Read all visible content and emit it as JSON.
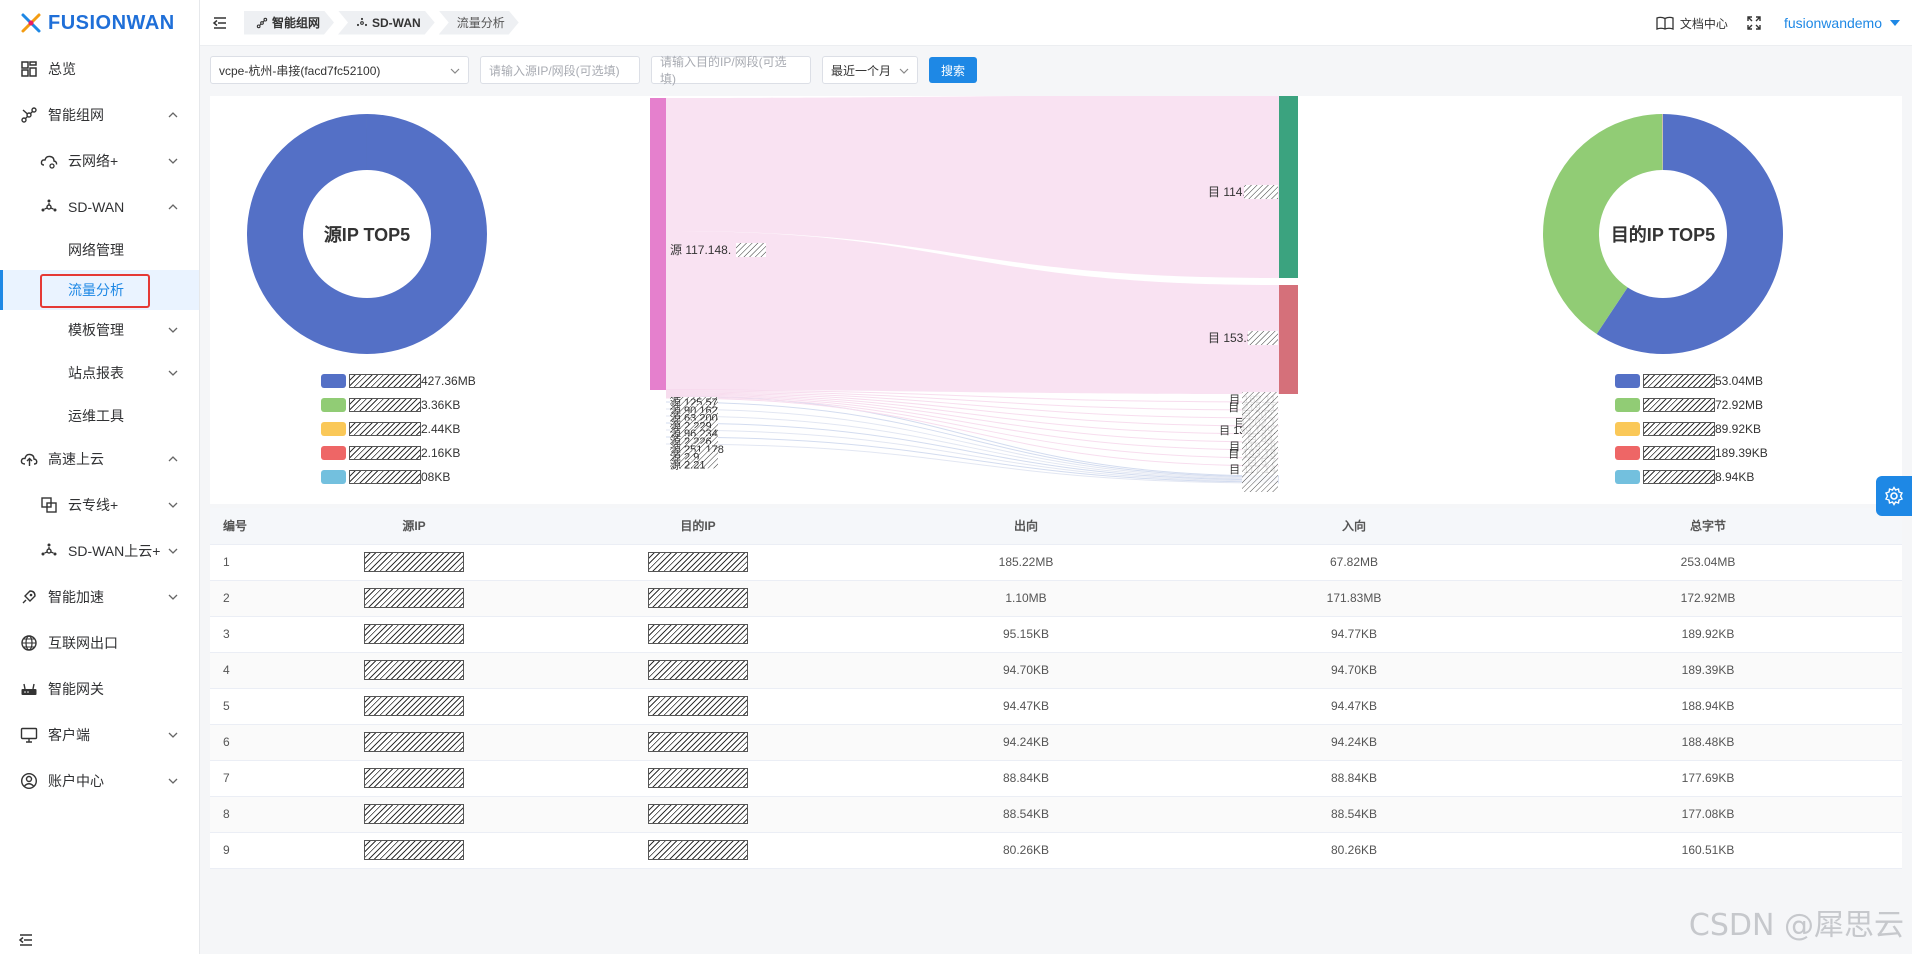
{
  "brand": {
    "name": "FUSIONWAN"
  },
  "sidebar": {
    "items": [
      {
        "label": "总览",
        "icon": "dashboard-icon"
      },
      {
        "label": "智能组网",
        "icon": "network-icon"
      },
      {
        "label": "云网络+",
        "icon": "cloud-network-icon"
      },
      {
        "label": "SD-WAN",
        "icon": "sdwan-icon"
      },
      {
        "label": "网络管理"
      },
      {
        "label": "流量分析"
      },
      {
        "label": "模板管理"
      },
      {
        "label": "站点报表"
      },
      {
        "label": "运维工具"
      },
      {
        "label": "高速上云",
        "icon": "cloud-upload-icon"
      },
      {
        "label": "云专线+",
        "icon": "dedicated-line-icon"
      },
      {
        "label": "SD-WAN上云+",
        "icon": "sdwan-cloud-icon"
      },
      {
        "label": "智能加速",
        "icon": "rocket-icon"
      },
      {
        "label": "互联网出口",
        "icon": "globe-icon"
      },
      {
        "label": "智能网关",
        "icon": "router-icon"
      },
      {
        "label": "客户端",
        "icon": "monitor-icon"
      },
      {
        "label": "账户中心",
        "icon": "user-circle-icon"
      }
    ]
  },
  "header": {
    "breadcrumbs": [
      "智能组网",
      "SD-WAN",
      "流量分析"
    ],
    "docs_label": "文档中心",
    "username": "fusionwandemo"
  },
  "filters": {
    "device": "vcpe-杭州-串接(facd7fc52100)",
    "src_placeholder": "请输入源IP/网段(可选填)",
    "dst_placeholder": "请输入目的IP/网段(可选填)",
    "period": "最近一个月",
    "search_label": "搜索"
  },
  "colors": {
    "accent": "#1e88e5",
    "series": [
      "#5470c6",
      "#91cc75",
      "#fac858",
      "#ee6666",
      "#73c0de"
    ]
  },
  "charts": {
    "src_title": "源IP TOP5",
    "src_legend": [
      "427.36MB",
      "3.36KB",
      "2.44KB",
      "2.16KB",
      "08KB"
    ],
    "dst_title": "目的IP TOP5",
    "dst_legend": [
      "53.04MB",
      "72.92MB",
      "89.92KB",
      "189.39KB",
      "8.94KB"
    ],
    "sankey_labels": {
      "source_main": "源 117.148.",
      "target_1": "目 114.118",
      "target_2": "目 153.37.",
      "source_small": [
        "源 125.57",
        "源 90.162",
        "源 63.200",
        "源 2.229",
        "源 96.234",
        "源 2.226",
        "源 251.178",
        "源 2.9",
        "源 2.21"
      ],
      "target_small": [
        "目 162.11",
        "目 219.21",
        "目 202.",
        "目 202.1",
        "目 139.199.",
        "目 84.",
        "目 119.28",
        "目 193.18",
        "目 5.7",
        "目 117.14"
      ]
    }
  },
  "chart_data": [
    {
      "type": "pie",
      "title": "源IP TOP5",
      "labels": [
        "427.36MB",
        "3.36KB",
        "2.44KB",
        "2.16KB",
        "08KB"
      ],
      "values": [
        427360,
        3.36,
        2.44,
        2.16,
        0.08
      ]
    },
    {
      "type": "pie",
      "title": "目的IP TOP5",
      "labels": [
        "53.04MB",
        "72.92MB",
        "89.92KB",
        "189.39KB",
        "8.94KB"
      ],
      "values": [
        253.04,
        172.92,
        0.19,
        0.19,
        0.19
      ]
    }
  ],
  "table": {
    "headers": [
      "编号",
      "源IP",
      "目的IP",
      "出向",
      "入向",
      "总字节"
    ],
    "rows": [
      [
        "1",
        "185.22MB",
        "67.82MB",
        "253.04MB"
      ],
      [
        "2",
        "1.10MB",
        "171.83MB",
        "172.92MB"
      ],
      [
        "3",
        "95.15KB",
        "94.77KB",
        "189.92KB"
      ],
      [
        "4",
        "94.70KB",
        "94.70KB",
        "189.39KB"
      ],
      [
        "5",
        "94.47KB",
        "94.47KB",
        "188.94KB"
      ],
      [
        "6",
        "94.24KB",
        "94.24KB",
        "188.48KB"
      ],
      [
        "7",
        "88.84KB",
        "88.84KB",
        "177.69KB"
      ],
      [
        "8",
        "88.54KB",
        "88.54KB",
        "177.08KB"
      ],
      [
        "9",
        "80.26KB",
        "80.26KB",
        "160.51KB"
      ]
    ]
  },
  "watermark": "CSDN @犀思云"
}
